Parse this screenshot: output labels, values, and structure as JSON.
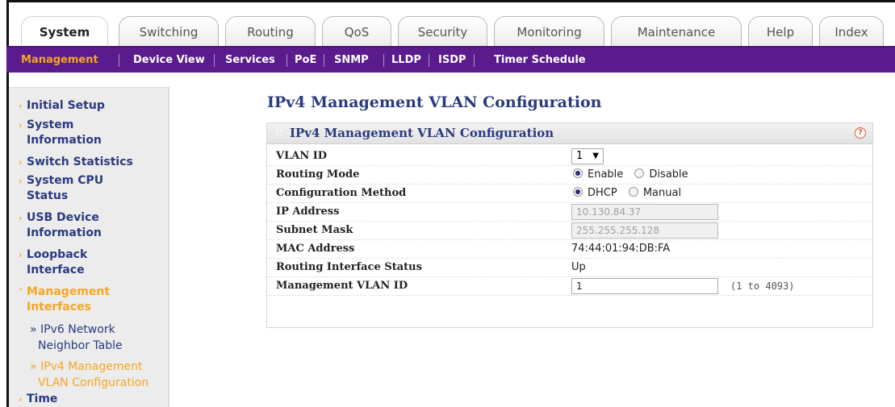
{
  "tabs": [
    "System",
    "Switching",
    "Routing",
    "QoS",
    "Security",
    "Monitoring",
    "Maintenance",
    "Help",
    "Index"
  ],
  "subnav": [
    "Management",
    "Device View",
    "Services",
    "PoE",
    "SNMP",
    "LLDP",
    "ISDP",
    "Timer Schedule"
  ],
  "sidebar": {
    "items": [
      {
        "label": "Initial Setup"
      },
      {
        "label": "System"
      },
      {
        "label": "Information"
      },
      {
        "label": "Switch Statistics"
      },
      {
        "label": "System CPU"
      },
      {
        "label": "Status"
      },
      {
        "label": "USB Device"
      },
      {
        "label": "Information"
      },
      {
        "label": "Loopback"
      },
      {
        "label": "Interface"
      },
      {
        "label": "Management"
      },
      {
        "label": "Interfaces"
      },
      {
        "label": "» IPv6 Network"
      },
      {
        "label": "Neighbor Table"
      },
      {
        "label": "» IPv4 Management"
      },
      {
        "label": "VLAN Configuration"
      },
      {
        "label": "Time"
      }
    ]
  },
  "page": {
    "title": "IPv4 Management VLAN Configuration",
    "panel_title": "IPv4 Management VLAN Configuration",
    "help_glyph": "?"
  },
  "form": {
    "vlan_id": {
      "label": "VLAN ID",
      "value": "1"
    },
    "routing_mode": {
      "label": "Routing Mode",
      "options": [
        "Enable",
        "Disable"
      ],
      "selected": "Enable"
    },
    "config_method": {
      "label": "Configuration Method",
      "options": [
        "DHCP",
        "Manual"
      ],
      "selected": "DHCP"
    },
    "ip_address": {
      "label": "IP Address",
      "value": "10.130.84.37"
    },
    "subnet_mask": {
      "label": "Subnet Mask",
      "value": "255.255.255.128"
    },
    "mac_address": {
      "label": "MAC Address",
      "value": "74:44:01:94:DB:FA"
    },
    "routing_status": {
      "label": "Routing Interface Status",
      "value": "Up"
    },
    "mgmt_vlan_id": {
      "label": "Management VLAN ID",
      "value": "1",
      "range": "(1 to 4093)"
    }
  },
  "colors": {
    "accent": "#5a1c8c",
    "highlight": "#f5a623",
    "link": "#2a3a80"
  }
}
